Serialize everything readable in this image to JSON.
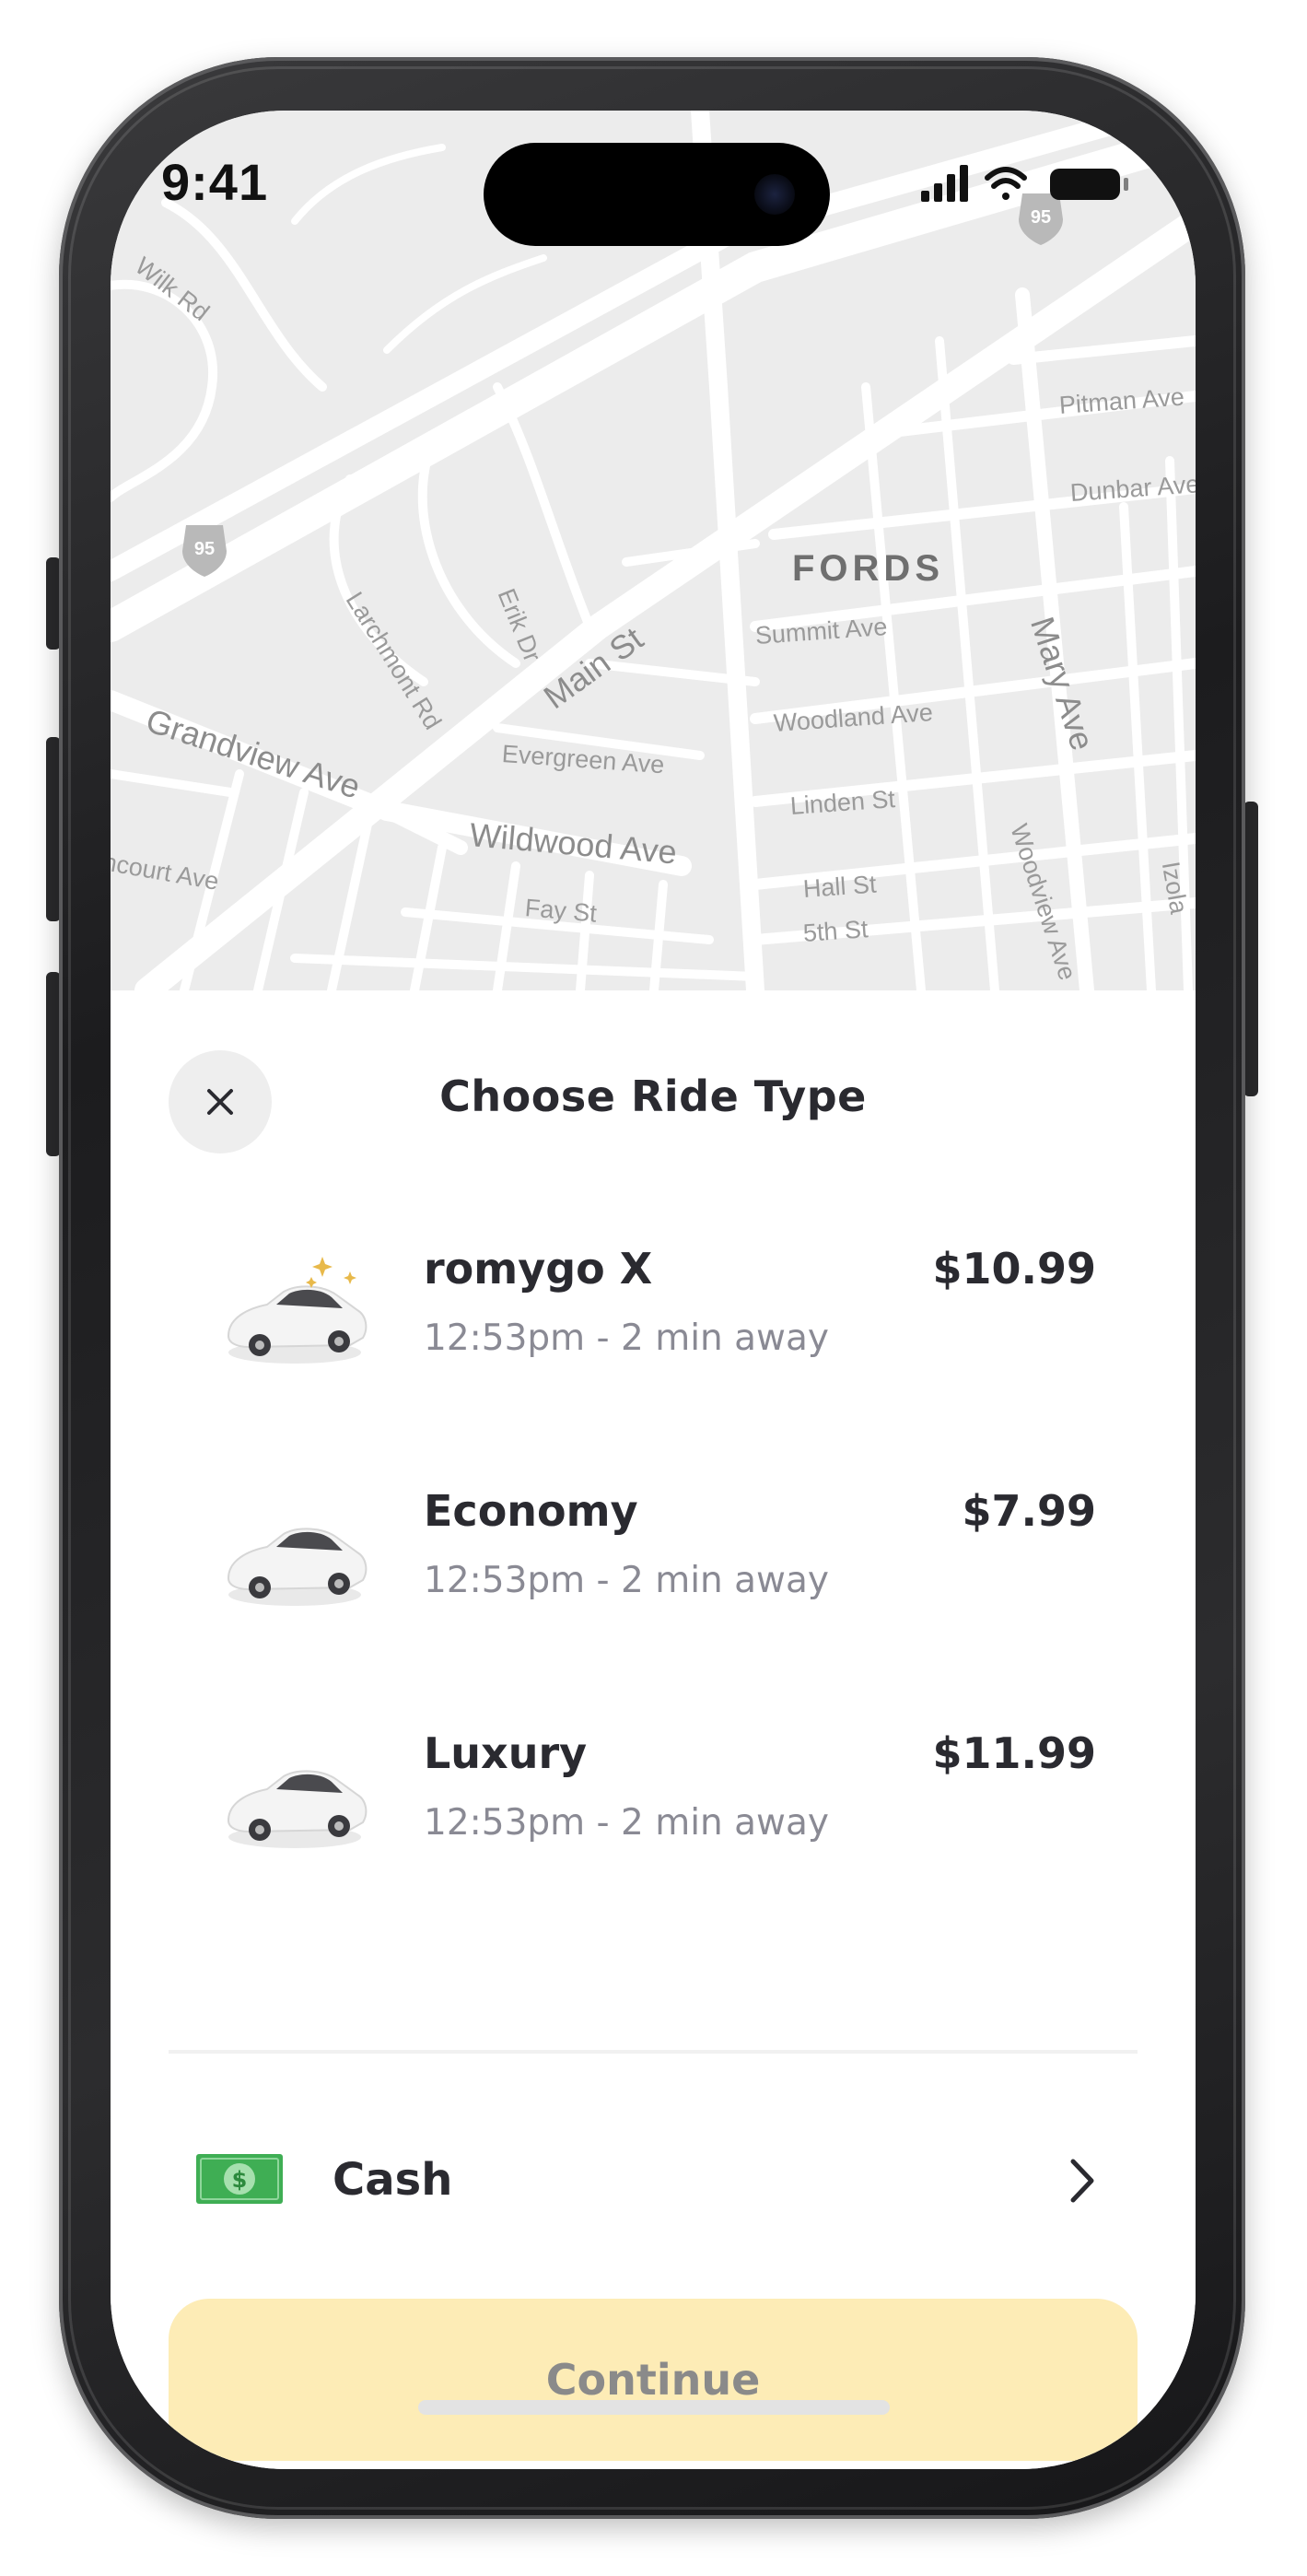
{
  "status_bar": {
    "time": "9:41"
  },
  "map": {
    "interstate_shield": "95",
    "labels": {
      "wilk_rd": "Wilk Rd",
      "pitman_ave": "Pitman Ave",
      "dunbar_ave": "Dunbar Ave",
      "fords": "FORDS",
      "larchmont_rd": "Larchmont Rd",
      "erik_dr": "Erik Dr",
      "main_st": "Main St",
      "summit_ave": "Summit Ave",
      "mary_ave": "Mary Ave",
      "grandview_ave": "Grandview Ave",
      "woodland_ave": "Woodland Ave",
      "evergreen_ave": "Evergreen Ave",
      "linden_st": "Linden St",
      "wildwood_ave": "Wildwood Ave",
      "vancourt_ave": "ncourt Ave",
      "woodview_ave": "Woodview Ave",
      "izola": "Izola",
      "fay_st": "Fay St",
      "hall_st": "Hall St",
      "fifth_st": "5th St"
    }
  },
  "sheet": {
    "title": "Choose Ride Type",
    "close_icon": "close-icon",
    "rides": [
      {
        "name": "romygo X",
        "eta": "12:53pm - 2 min away",
        "price": "$10.99",
        "icon": "car-sparkle-icon"
      },
      {
        "name": "Economy",
        "eta": "12:53pm - 2 min away",
        "price": "$7.99",
        "icon": "car-icon"
      },
      {
        "name": "Luxury",
        "eta": "12:53pm - 2 min away",
        "price": "$11.99",
        "icon": "car-icon"
      }
    ],
    "payment": {
      "label": "Cash",
      "icon": "cash-icon"
    },
    "continue_label": "Continue"
  },
  "colors": {
    "continue_bg": "#fdecb6",
    "cash_green": "#3fae54",
    "text_primary": "#2a2a30",
    "text_secondary": "#8a8a94"
  }
}
